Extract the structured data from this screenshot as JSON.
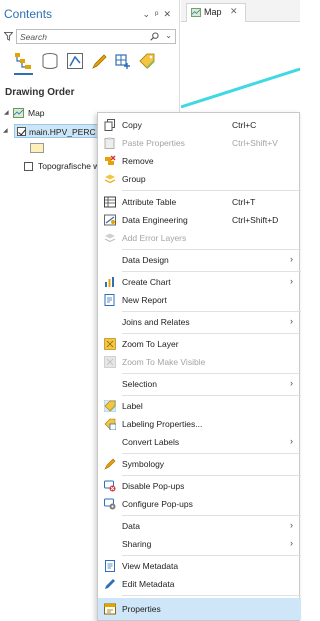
{
  "contents_pane": {
    "title": "Contents",
    "controls": [
      "⌄",
      "ᵖ",
      "✕"
    ],
    "search": {
      "placeholder": "Search",
      "value": ""
    },
    "section_title": "Drawing Order",
    "map_label": "Map",
    "layer_label": "main.HPV_PERC",
    "topo_label": "Topografische w"
  },
  "map_view": {
    "tab_label": "Map",
    "tab_close": "✕",
    "line_color": "#3fd8e4"
  },
  "context_menu": {
    "items": [
      {
        "label": "Copy",
        "shortcut": "Ctrl+C",
        "icon": "copy-icon",
        "enabled": true
      },
      {
        "label": "Paste Properties",
        "shortcut": "Ctrl+Shift+V",
        "icon": "paste-properties-icon",
        "enabled": false
      },
      {
        "label": "Remove",
        "icon": "remove-icon",
        "enabled": true
      },
      {
        "label": "Group",
        "icon": "group-icon",
        "enabled": true
      },
      {
        "label": "Attribute Table",
        "shortcut": "Ctrl+T",
        "icon": "attribute-table-icon",
        "enabled": true
      },
      {
        "label": "Data Engineering",
        "shortcut": "Ctrl+Shift+D",
        "icon": "data-engineering-icon",
        "enabled": true
      },
      {
        "label": "Add Error Layers",
        "icon": "add-error-layers-icon",
        "enabled": false
      },
      {
        "label": "Data Design",
        "submenu": "›",
        "enabled": true
      },
      {
        "label": "Create Chart",
        "submenu": "›",
        "icon": "chart-icon",
        "enabled": true
      },
      {
        "label": "New Report",
        "icon": "report-icon",
        "enabled": true
      },
      {
        "label": "Joins and Relates",
        "submenu": "›",
        "enabled": true
      },
      {
        "label": "Zoom To Layer",
        "icon": "zoom-to-layer-icon",
        "enabled": true
      },
      {
        "label": "Zoom To Make Visible",
        "icon": "zoom-to-visible-icon",
        "enabled": false
      },
      {
        "label": "Selection",
        "submenu": "›",
        "enabled": true
      },
      {
        "label": "Label",
        "icon": "label-icon",
        "enabled": true
      },
      {
        "label": "Labeling Properties...",
        "icon": "labeling-properties-icon",
        "enabled": true
      },
      {
        "label": "Convert Labels",
        "submenu": "›",
        "enabled": true
      },
      {
        "label": "Symbology",
        "icon": "symbology-icon",
        "enabled": true
      },
      {
        "label": "Disable Pop-ups",
        "icon": "disable-popups-icon",
        "enabled": true
      },
      {
        "label": "Configure Pop-ups",
        "icon": "configure-popups-icon",
        "enabled": true
      },
      {
        "label": "Data",
        "submenu": "›",
        "enabled": true
      },
      {
        "label": "Sharing",
        "submenu": "›",
        "enabled": true
      },
      {
        "label": "View Metadata",
        "icon": "view-metadata-icon",
        "enabled": true
      },
      {
        "label": "Edit Metadata",
        "icon": "edit-metadata-icon",
        "enabled": true
      },
      {
        "label": "Properties",
        "icon": "properties-icon",
        "enabled": true,
        "highlighted": true
      }
    ]
  },
  "colors": {
    "accent": "#2f6fb5",
    "selection": "#cfe5f8",
    "disabled_text": "#a3a3a3"
  }
}
